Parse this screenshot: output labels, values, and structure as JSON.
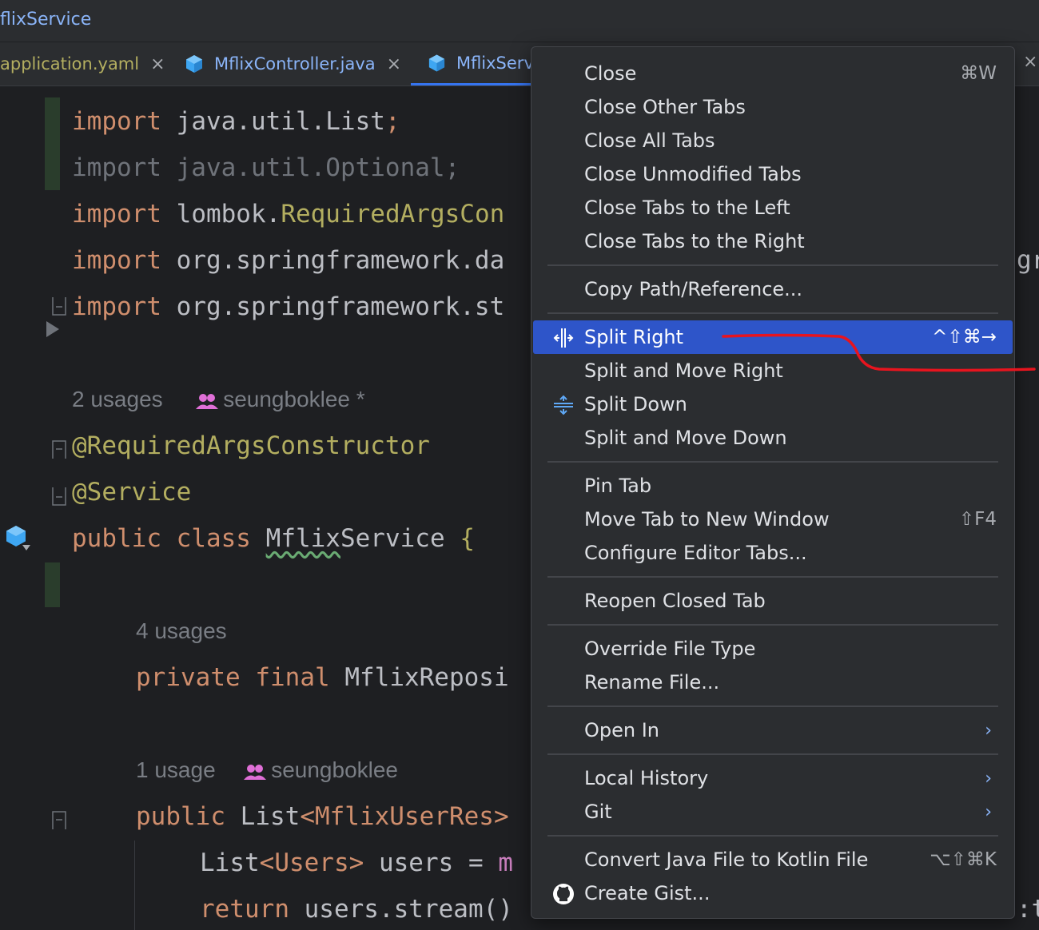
{
  "window": {
    "title": "flixService"
  },
  "tabs": [
    {
      "label": "application.yaml",
      "close": "×"
    },
    {
      "label": "MflixController.java",
      "close": "×"
    },
    {
      "label": "MflixServ",
      "close": "×"
    }
  ],
  "editor": {
    "lines": {
      "import_list": {
        "kw": "import",
        "rest": "java.util.List",
        "semi": ";"
      },
      "import_optional": {
        "text": "import java.util.Optional;"
      },
      "import_lombok": {
        "kw": "import",
        "pkg": "lombok.",
        "cls": "RequiredArgsCon"
      },
      "import_spring_data": {
        "kw": "import",
        "rest": "org.springframework.da"
      },
      "import_spring_st": {
        "kw": "import",
        "rest": "org.springframework.st"
      },
      "usages_class": {
        "count": "2 usages",
        "author": "seungboklee *"
      },
      "annotation_rac": "@RequiredArgsConstructor",
      "annotation_service": "@Service",
      "class_decl": {
        "kw1": "public",
        "kw2": "class",
        "name_ul": "Mflix",
        "name_rest": "Service",
        "brace": "{"
      },
      "usages_field": {
        "count": "4 usages"
      },
      "field_decl": {
        "kw1": "private",
        "kw2": "final",
        "type": "MflixReposi"
      },
      "usages_method": {
        "count": "1 usage",
        "author": "seungboklee"
      },
      "method_decl": {
        "kw": "public",
        "type": "List",
        "generic": "<MflixUserRes>"
      },
      "list_users": {
        "type": "List",
        "generic": "<Users>",
        "rest": " users = ",
        "tail": "m"
      },
      "return_stmt": {
        "kw": "return",
        "rest": " users.stream()"
      }
    },
    "right_edge": {
      "top": "gr",
      "bottom": ":t"
    }
  },
  "context_menu": {
    "items": [
      {
        "label": "Close",
        "shortcut": "⌘W"
      },
      {
        "label": "Close Other Tabs"
      },
      {
        "label": "Close All Tabs"
      },
      {
        "label": "Close Unmodified Tabs"
      },
      {
        "label": "Close Tabs to the Left"
      },
      {
        "label": "Close Tabs to the Right"
      },
      {
        "label": "Copy Path/Reference..."
      },
      {
        "label": "Split Right",
        "shortcut": "^⇧⌘→"
      },
      {
        "label": "Split and Move Right"
      },
      {
        "label": "Split Down"
      },
      {
        "label": "Split and Move Down"
      },
      {
        "label": "Pin Tab"
      },
      {
        "label": "Move Tab to New Window",
        "shortcut": "⇧F4"
      },
      {
        "label": "Configure Editor Tabs..."
      },
      {
        "label": "Reopen Closed Tab"
      },
      {
        "label": "Override File Type"
      },
      {
        "label": "Rename File..."
      },
      {
        "label": "Open In",
        "arrow": "›"
      },
      {
        "label": "Local History",
        "arrow": "›"
      },
      {
        "label": "Git",
        "arrow": "›"
      },
      {
        "label": "Convert Java File to Kotlin File",
        "shortcut": "⌥⇧⌘K"
      },
      {
        "label": "Create Gist..."
      }
    ]
  },
  "colors": {
    "accent_selection": "#2e55c9",
    "annotation_stroke": "#e8141e",
    "keyword": "#cf8e6d",
    "annotation": "#b3ae60"
  }
}
